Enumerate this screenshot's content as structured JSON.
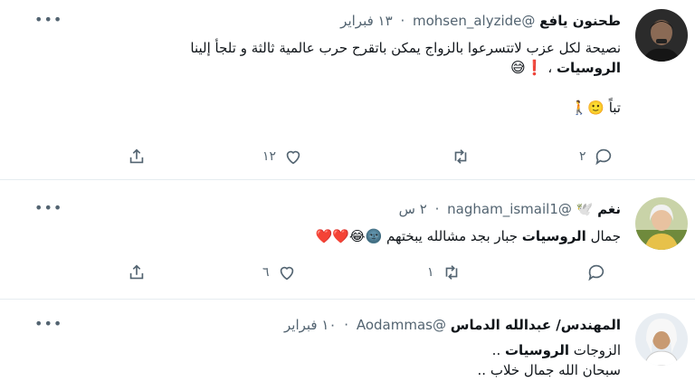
{
  "tweets": [
    {
      "name": "طحنون يافع",
      "handle": "@mohsen_alyzide",
      "time": "١٣ فبراير",
      "lines": [
        "نصيحة لكل عزب  لاتتسرعوا  بالزواج  يمكن باتقرح  حرب عالمية ثالثة و تلجأ إلينا"
      ],
      "highlight": "الروسيات",
      "after_highlight": " ، ",
      "emoji_line": "❗😅",
      "extra_line": "تباً 🙂🚶",
      "reply_count": "٢",
      "retweet_count": "",
      "like_count": "١٢"
    },
    {
      "name": "نغم",
      "name_emoji": "🕊️",
      "handle": "@nagham_ismail1",
      "time": "٢ س",
      "prefix": "جمال ",
      "highlight": "الروسيات",
      "suffix": " جبار بجد مشالله يبختهم 🌚😂❤️❤️",
      "reply_count": "",
      "retweet_count": "١",
      "like_count": "٦"
    },
    {
      "name": "المهندس/ عبدالله الدماس",
      "handle": "@Aodammas",
      "time": "١٠ فبراير",
      "prefix": "الزوجات ",
      "highlight": "الروسيات",
      "suffix": " ..",
      "line2": "سبحان الله جمال خلاب .."
    }
  ],
  "colors": {
    "text": "#0f1419",
    "secondary": "#536471",
    "divider": "#e6ecf0"
  },
  "icons": [
    "more-icon",
    "reply-icon",
    "retweet-icon",
    "like-icon",
    "share-icon"
  ]
}
